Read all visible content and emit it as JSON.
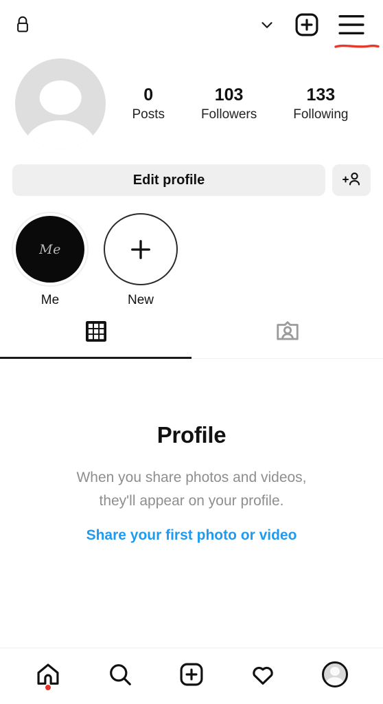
{
  "header": {
    "lock_icon": "lock-icon",
    "chevron_icon": "chevron-down-icon",
    "create_icon": "plus-square-icon",
    "menu_icon": "hamburger-menu-icon",
    "annotation_color": "#e8372c"
  },
  "profile": {
    "avatar": "default-avatar-placeholder",
    "stats": [
      {
        "value": "0",
        "label": "Posts"
      },
      {
        "value": "103",
        "label": "Followers"
      },
      {
        "value": "133",
        "label": "Following"
      }
    ]
  },
  "actions": {
    "edit_profile_label": "Edit profile",
    "add_person_icon": "add-person-icon"
  },
  "highlights": [
    {
      "label": "Me",
      "thumb_text": "Me",
      "type": "story"
    },
    {
      "label": "New",
      "thumb_text": "+",
      "type": "new"
    }
  ],
  "tabs": [
    {
      "name": "grid",
      "icon": "grid-icon",
      "active": true
    },
    {
      "name": "tagged",
      "icon": "tagged-icon",
      "active": false
    }
  ],
  "empty_state": {
    "title": "Profile",
    "line1": "When you share photos and videos,",
    "line2": "they'll appear on your profile.",
    "link": "Share your first photo or video",
    "link_color": "#1e9bf0"
  },
  "bottom_nav": [
    {
      "name": "home",
      "icon": "home-icon",
      "badge": true,
      "active": false
    },
    {
      "name": "search",
      "icon": "search-icon",
      "badge": false,
      "active": false
    },
    {
      "name": "create",
      "icon": "plus-square-icon",
      "badge": false,
      "active": false
    },
    {
      "name": "activity",
      "icon": "heart-icon",
      "badge": false,
      "active": false
    },
    {
      "name": "profile",
      "icon": "avatar-icon",
      "badge": false,
      "active": true
    }
  ]
}
